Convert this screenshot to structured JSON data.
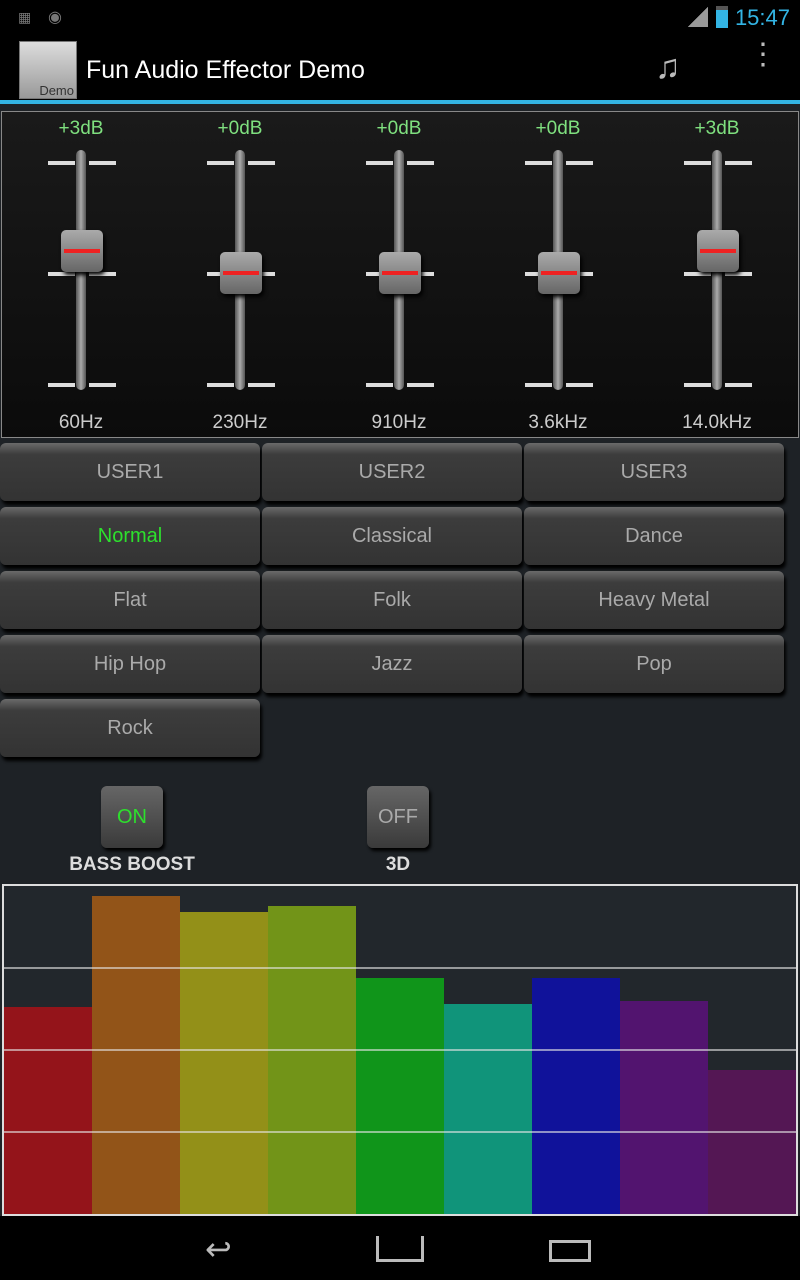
{
  "status_bar": {
    "time": "15:47",
    "icons": [
      "notification-equalizer-icon",
      "notification-record-icon",
      "signal-icon",
      "battery-charging-icon"
    ]
  },
  "action_bar": {
    "title": "Fun Audio Effector Demo",
    "icon_label": "Demo",
    "actions": [
      "music-note-icon",
      "overflow-menu-icon"
    ]
  },
  "equalizer": {
    "bands": [
      {
        "freq": "60Hz",
        "gain_label": "+3dB",
        "gain_db": 3
      },
      {
        "freq": "230Hz",
        "gain_label": "+0dB",
        "gain_db": 0
      },
      {
        "freq": "910Hz",
        "gain_label": "+0dB",
        "gain_db": 0
      },
      {
        "freq": "3.6kHz",
        "gain_label": "+0dB",
        "gain_db": 0
      },
      {
        "freq": "14.0kHz",
        "gain_label": "+3dB",
        "gain_db": 3
      }
    ]
  },
  "presets": {
    "selected": "Normal",
    "items": [
      "USER1",
      "USER2",
      "USER3",
      "Normal",
      "Classical",
      "Dance",
      "Flat",
      "Folk",
      "Heavy Metal",
      "Hip Hop",
      "Jazz",
      "Pop",
      "Rock"
    ]
  },
  "toggles": [
    {
      "label": "BASS BOOST",
      "state": "ON"
    },
    {
      "label": "3D",
      "state": "OFF"
    }
  ],
  "visualizer": {
    "levels": [
      0.63,
      0.97,
      0.92,
      0.94,
      0.72,
      0.64,
      0.72,
      0.65,
      0.44
    ],
    "colors": [
      "#94141a",
      "#925418",
      "#939018",
      "#729418",
      "#10951a",
      "#10947a",
      "#10129a",
      "#52146f",
      "#541754"
    ]
  },
  "colors": {
    "accent": "#33b5e5",
    "selected": "#2de02d",
    "gain_label": "#7fe07f"
  }
}
